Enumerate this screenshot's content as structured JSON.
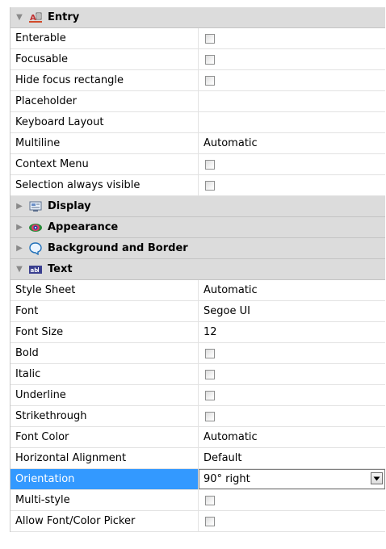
{
  "sections": {
    "entry": {
      "title": "Entry",
      "icon": "entry-icon",
      "expanded": true
    },
    "display": {
      "title": "Display",
      "icon": "display-icon",
      "expanded": false
    },
    "appearance": {
      "title": "Appearance",
      "icon": "appearance-icon",
      "expanded": false
    },
    "background": {
      "title": "Background and Border",
      "icon": "background-border-icon",
      "expanded": false
    },
    "text": {
      "title": "Text",
      "icon": "text-icon",
      "expanded": true
    }
  },
  "entry_props": [
    {
      "label": "Enterable",
      "type": "checkbox"
    },
    {
      "label": "Focusable",
      "type": "checkbox"
    },
    {
      "label": "Hide focus rectangle",
      "type": "checkbox"
    },
    {
      "label": "Placeholder",
      "type": "text",
      "value": ""
    },
    {
      "label": "Keyboard Layout",
      "type": "text",
      "value": ""
    },
    {
      "label": "Multiline",
      "type": "text",
      "value": "Automatic"
    },
    {
      "label": "Context Menu",
      "type": "checkbox"
    },
    {
      "label": "Selection always visible",
      "type": "checkbox"
    }
  ],
  "text_props": [
    {
      "label": "Style Sheet",
      "type": "text",
      "value": "Automatic"
    },
    {
      "label": "Font",
      "type": "text",
      "value": "Segoe UI"
    },
    {
      "label": "Font Size",
      "type": "text",
      "value": "12"
    },
    {
      "label": "Bold",
      "type": "checkbox"
    },
    {
      "label": "Italic",
      "type": "checkbox"
    },
    {
      "label": "Underline",
      "type": "checkbox"
    },
    {
      "label": "Strikethrough",
      "type": "checkbox"
    },
    {
      "label": "Font Color",
      "type": "text",
      "value": "Automatic"
    },
    {
      "label": "Horizontal Alignment",
      "type": "text",
      "value": "Default"
    },
    {
      "label": "Orientation",
      "type": "dropdown",
      "value": "90° right",
      "selected": true
    },
    {
      "label": "Multi-style",
      "type": "checkbox"
    },
    {
      "label": "Allow Font/Color Picker",
      "type": "checkbox"
    }
  ],
  "colors": {
    "section_bg": "#dcdcdc",
    "selection": "#3399ff"
  }
}
